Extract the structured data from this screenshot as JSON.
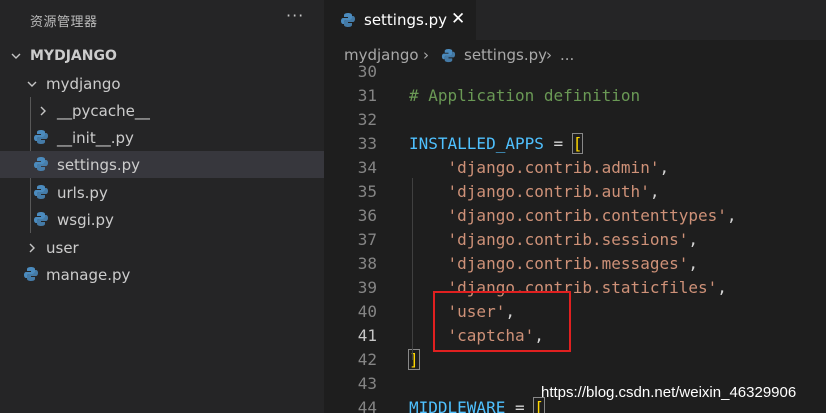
{
  "explorer": {
    "title": "资源管理器",
    "more_glyph": "···",
    "root": "MYDJANGO",
    "items": [
      {
        "label": "mydjango",
        "kind": "folder-open"
      },
      {
        "label": "__pycache__",
        "kind": "folder-closed"
      },
      {
        "label": "__init__.py",
        "kind": "python-file"
      },
      {
        "label": "settings.py",
        "kind": "python-file",
        "selected": true
      },
      {
        "label": "urls.py",
        "kind": "python-file"
      },
      {
        "label": "wsgi.py",
        "kind": "python-file"
      },
      {
        "label": "user",
        "kind": "folder-closed"
      },
      {
        "label": "manage.py",
        "kind": "python-file"
      }
    ]
  },
  "editor": {
    "tab": {
      "label": "settings.py",
      "close_glyph": "✕"
    },
    "breadcrumb": [
      "mydjango",
      "settings.py",
      "..."
    ],
    "active_line": 41,
    "lines": [
      {
        "n": "30",
        "text": ""
      },
      {
        "n": "31",
        "text": "# Application definition"
      },
      {
        "n": "32",
        "text": ""
      },
      {
        "n": "33",
        "text": "INSTALLED_APPS = ["
      },
      {
        "n": "34",
        "text": "    'django.contrib.admin',"
      },
      {
        "n": "35",
        "text": "    'django.contrib.auth',"
      },
      {
        "n": "36",
        "text": "    'django.contrib.contenttypes',"
      },
      {
        "n": "37",
        "text": "    'django.contrib.sessions',"
      },
      {
        "n": "38",
        "text": "    'django.contrib.messages',"
      },
      {
        "n": "39",
        "text": "    'django.contrib.staticfiles',"
      },
      {
        "n": "40",
        "text": "    'user',"
      },
      {
        "n": "41",
        "text": "    'captcha',"
      },
      {
        "n": "42",
        "text": "]"
      },
      {
        "n": "43",
        "text": ""
      },
      {
        "n": "44",
        "text": "MIDDLEWARE = ["
      }
    ]
  },
  "watermark": "https://blog.csdn.net/weixin_46329906",
  "colors": {
    "sidebar_bg": "#252526",
    "editor_bg": "#1e1e1e",
    "selected_row": "#37373d",
    "comment": "#6a9955",
    "identifier": "#4fc1ff",
    "string": "#ce9178",
    "bracket": "#ffd700",
    "annotation_box": "#e02020",
    "python_icon": "#4b8bbe"
  }
}
